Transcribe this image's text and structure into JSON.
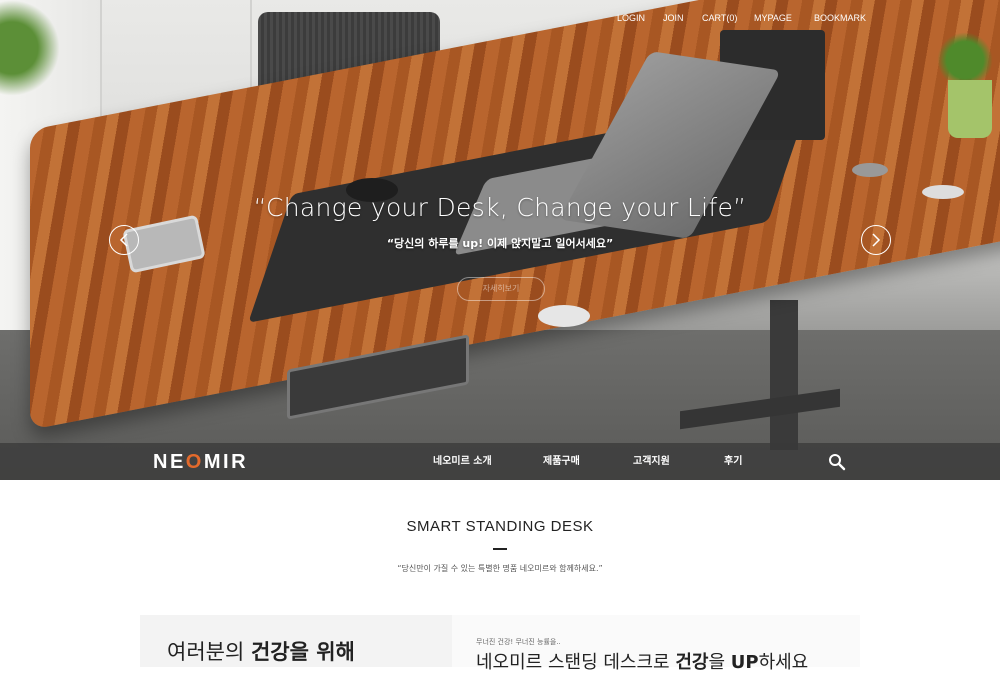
{
  "top_menu": {
    "login": "LOGIN",
    "join": "JOIN",
    "cart": "CART(0)",
    "mypage": "MYPAGE",
    "bookmark": "BOOKMARK"
  },
  "hero": {
    "title": "“Change your Desk, Change your Life”",
    "subtitle": "“당신의 하루를 up! 이제 앉지말고 일어서세요”",
    "button_label": "자세히보기"
  },
  "nav": {
    "logo_part1": "NE",
    "logo_accent": "O",
    "logo_part2": "MIR",
    "items": [
      "네오미르 소개",
      "제품구매",
      "고객지원",
      "후기"
    ]
  },
  "section": {
    "title": "SMART STANDING DESK",
    "subtitle": "“당신만이 가질 수 있는 특별한 명품 네오미르와 함께하세요.”"
  },
  "feature": {
    "left_prefix": "여러분의 ",
    "left_bold": "건강을 위해",
    "note": "무너진 건강! 무너진 능률을..",
    "line_prefix": "네오미르 스탠딩 데스크로 ",
    "line_bold1": "건강",
    "line_mid": "을 ",
    "line_bold2": "UP",
    "line_suffix": "하세요"
  },
  "colors": {
    "accent": "#e36a2c",
    "navbar": "#3a3a3a"
  },
  "icons": {
    "prev": "chevron-left-icon",
    "next": "chevron-right-icon",
    "search": "search-icon"
  }
}
